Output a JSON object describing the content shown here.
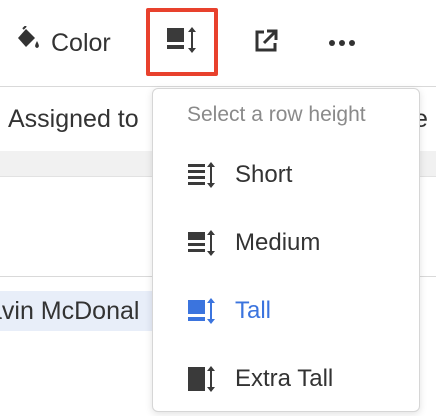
{
  "toolbar": {
    "color_label": "Color",
    "color_icon": "paint-bucket-icon",
    "row_height_icon": "row-height-icon",
    "share_icon": "open-external-icon",
    "more_icon": "more-horizontal-icon",
    "highlight_color": "#e8412d"
  },
  "grid": {
    "columns": [
      "Assigned to",
      "e"
    ],
    "cells": {
      "assigned_value": "avin McDonal"
    }
  },
  "row_height_menu": {
    "heading": "Select a row height",
    "selected": "Tall",
    "selected_color": "#3b74de",
    "options": [
      {
        "label": "Short",
        "icon": "row-height-short-icon"
      },
      {
        "label": "Medium",
        "icon": "row-height-medium-icon"
      },
      {
        "label": "Tall",
        "icon": "row-height-tall-icon"
      },
      {
        "label": "Extra Tall",
        "icon": "row-height-extra-tall-icon"
      }
    ]
  }
}
